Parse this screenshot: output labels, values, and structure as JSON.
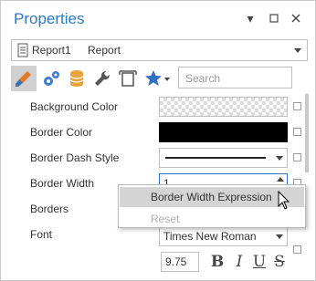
{
  "window": {
    "title": "Properties",
    "controls": [
      "pin",
      "maximize",
      "close"
    ]
  },
  "selector": {
    "name": "Report1",
    "type": "Report"
  },
  "toolbar": {
    "buttons": [
      {
        "icon": "brush-icon",
        "active": true
      },
      {
        "icon": "gears-icon",
        "active": false
      },
      {
        "icon": "database-icon",
        "active": false
      },
      {
        "icon": "wrench-icon",
        "active": false
      },
      {
        "icon": "layout-icon",
        "active": false
      },
      {
        "icon": "star-icon",
        "active": false
      }
    ],
    "search_placeholder": "Search"
  },
  "properties": [
    {
      "label": "Background Color",
      "editor": "color-transparent"
    },
    {
      "label": "Border Color",
      "editor": "color",
      "color": "#000000"
    },
    {
      "label": "Border Dash Style",
      "editor": "dash-dropdown"
    },
    {
      "label": "Border Width",
      "editor": "spin",
      "value": "1"
    },
    {
      "label": "Borders",
      "editor": "none"
    },
    {
      "label": "Font",
      "editor": "font",
      "value": "Times New Roman",
      "size": "9.75"
    }
  ],
  "font_formatting": [
    "B",
    "I",
    "U",
    "S"
  ],
  "context_menu": [
    {
      "label": "Border Width Expression",
      "state": "hover"
    },
    {
      "label": "Reset",
      "state": "disabled"
    }
  ],
  "colors": {
    "title": "#2b79c2",
    "accent_border": "#2b79c2",
    "menu_hover": "#d4d4d4",
    "disabled_text": "#b0b0b0"
  }
}
